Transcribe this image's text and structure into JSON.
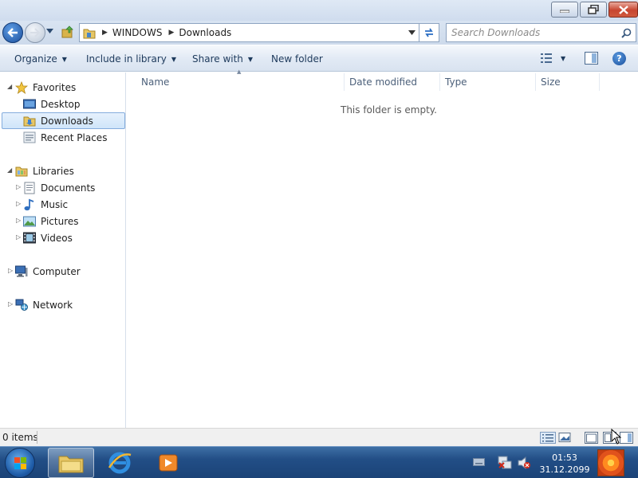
{
  "window": {
    "buttons": {
      "minimize": "minimize",
      "maximize": "restore",
      "close": "close"
    }
  },
  "address": {
    "crumbs": [
      "WINDOWS",
      "Downloads"
    ],
    "search_placeholder": "Search Downloads"
  },
  "toolbar": {
    "organize": "Organize",
    "include_in_library": "Include in library",
    "share_with": "Share with",
    "new_folder": "New folder",
    "help": "?"
  },
  "navpane": {
    "favorites": {
      "label": "Favorites",
      "items": [
        "Desktop",
        "Downloads",
        "Recent Places"
      ]
    },
    "libraries": {
      "label": "Libraries",
      "items": [
        "Documents",
        "Music",
        "Pictures",
        "Videos"
      ]
    },
    "computer": "Computer",
    "network": "Network"
  },
  "columns": [
    "Name",
    "Date modified",
    "Type",
    "Size"
  ],
  "content": {
    "empty_message": "This folder is empty."
  },
  "status": {
    "item_count": "0 items"
  },
  "taskbar": {
    "clock_time": "01:53",
    "clock_date": "31.12.2099"
  },
  "colors": {
    "accent": "#1c4f9c",
    "selection_border": "#84acdd",
    "taskbar": "#224e86"
  }
}
